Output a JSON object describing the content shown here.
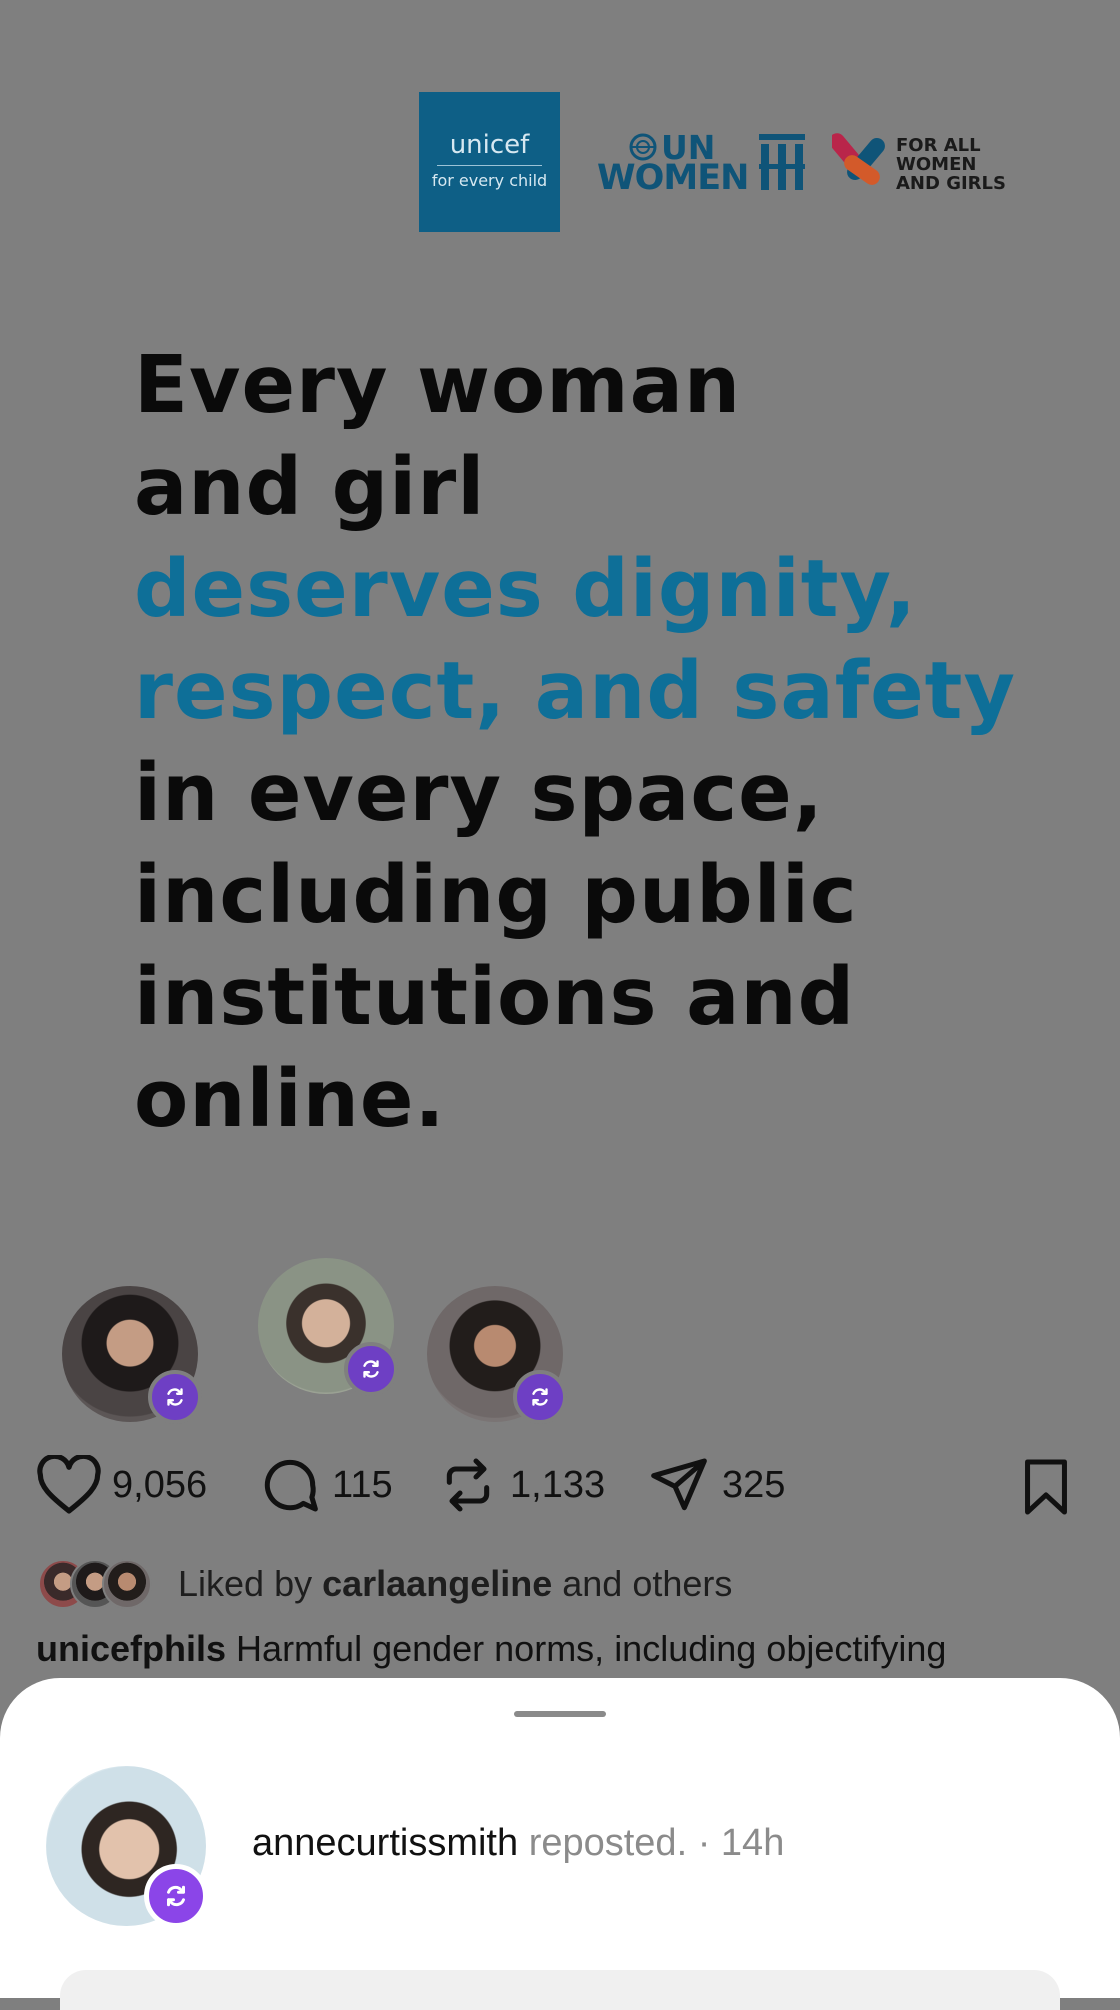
{
  "logos": {
    "unicef": {
      "name": "unicef",
      "tagline": "for every child"
    },
    "unwomen": {
      "line1": "UN",
      "line2": "WOMEN"
    },
    "campaign": {
      "line1_prefix": "FOR ",
      "line1_bold": "ALL",
      "line2": "WOMEN",
      "line3": "AND GIRLS"
    }
  },
  "headline": {
    "lines": [
      {
        "text": "Every woman",
        "accent": false
      },
      {
        "text": "and girl",
        "accent": false
      },
      {
        "text": "deserves dignity,",
        "accent": true
      },
      {
        "text": "respect, and safety",
        "accent": true
      },
      {
        "text": "in every space,",
        "accent": false
      },
      {
        "text": "including public",
        "accent": false
      },
      {
        "text": "institutions and",
        "accent": false
      },
      {
        "text": "online.",
        "accent": false
      }
    ]
  },
  "actions": {
    "likes": "9,056",
    "comments": "115",
    "reposts": "1,133",
    "shares": "325"
  },
  "liked_by": {
    "prefix": "Liked by",
    "user": "carlaangeline",
    "suffix": "and others"
  },
  "caption": {
    "user": "unicefphils",
    "text": "Harmful gender norms, including objectifying"
  },
  "sheet": {
    "username": "annecurtissmith",
    "action": "reposted.",
    "separator": "·",
    "time": "14h"
  },
  "colors": {
    "accent_text": "#0e6f98",
    "unicef_blue": "#0e5f86",
    "repost_badge": "#8b45e8",
    "overlay": "#7f7f7f"
  },
  "icons": [
    "heart-icon",
    "comment-icon",
    "repost-icon",
    "share-icon",
    "bookmark-icon",
    "globe-icon"
  ]
}
